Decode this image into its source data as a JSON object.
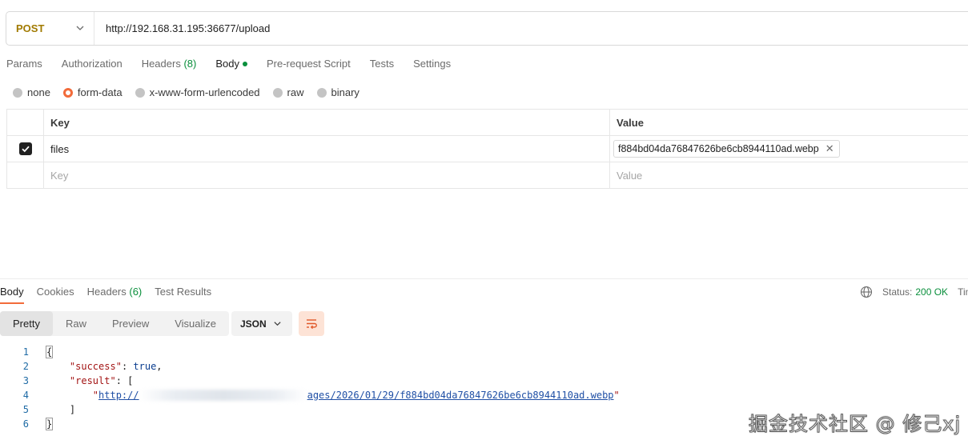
{
  "request": {
    "method": "POST",
    "url": "http://192.168.31.195:36677/upload"
  },
  "request_tabs": [
    {
      "label": "Params"
    },
    {
      "label": "Authorization"
    },
    {
      "label": "Headers",
      "count": "(8)"
    },
    {
      "label": "Body"
    },
    {
      "label": "Pre-request Script"
    },
    {
      "label": "Tests"
    },
    {
      "label": "Settings"
    }
  ],
  "body_types": [
    {
      "label": "none"
    },
    {
      "label": "form-data"
    },
    {
      "label": "x-www-form-urlencoded"
    },
    {
      "label": "raw"
    },
    {
      "label": "binary"
    }
  ],
  "table": {
    "key_header": "Key",
    "value_header": "Value",
    "rows": [
      {
        "key": "files",
        "value": "f884bd04da76847626be6cb8944110ad.webp",
        "checked": true
      }
    ],
    "key_placeholder": "Key",
    "value_placeholder": "Value"
  },
  "response_tabs": [
    {
      "label": "Body"
    },
    {
      "label": "Cookies"
    },
    {
      "label": "Headers",
      "count": "(6)"
    },
    {
      "label": "Test Results"
    }
  ],
  "status": {
    "label": "Status:",
    "value": "200 OK",
    "time_label": "Tim"
  },
  "view_tabs": [
    {
      "label": "Pretty"
    },
    {
      "label": "Raw"
    },
    {
      "label": "Preview"
    },
    {
      "label": "Visualize"
    }
  ],
  "format": "JSON",
  "code": {
    "line_numbers": [
      "1",
      "2",
      "3",
      "4",
      "5",
      "6"
    ],
    "l1": "{",
    "success_key": "\"success\"",
    "success_val": "true",
    "result_key": "\"result\"",
    "result_open": "[",
    "url_prefix": "http://",
    "url_suffix": "ages/2026/01/29/f884bd04da76847626be6cb8944110ad.webp",
    "l5": "]",
    "l6": "}"
  },
  "watermark": "掘金技术社区 @ 修己xj"
}
